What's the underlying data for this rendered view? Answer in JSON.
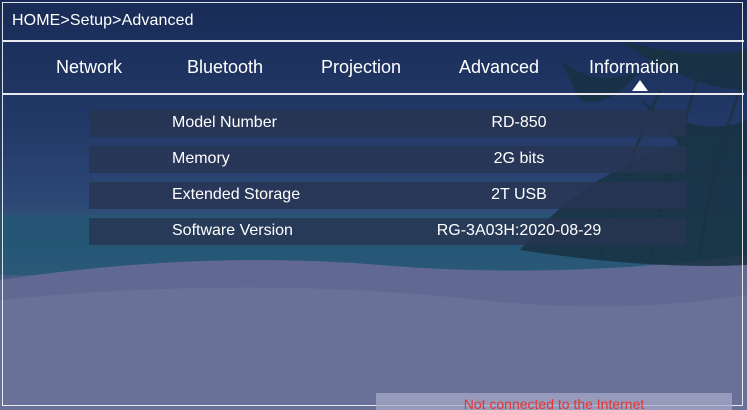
{
  "breadcrumb": "HOME>Setup>Advanced",
  "tabs": [
    {
      "label": "Network"
    },
    {
      "label": "Bluetooth"
    },
    {
      "label": "Projection"
    },
    {
      "label": "Advanced"
    },
    {
      "label": "Information",
      "selected": true
    }
  ],
  "info": [
    {
      "label": "Model Number",
      "value": "RD-850"
    },
    {
      "label": "Memory",
      "value": "2G bits"
    },
    {
      "label": "Extended Storage",
      "value": "2T USB"
    },
    {
      "label": "Software Version",
      "value": "RG-3A03H:2020-08-29"
    }
  ],
  "status": {
    "text": "Not connected to the Internet",
    "color": "#e8332f"
  },
  "colors": {
    "text": "#ffffff",
    "row_bg": "#283452",
    "accent": "#ffffff"
  }
}
